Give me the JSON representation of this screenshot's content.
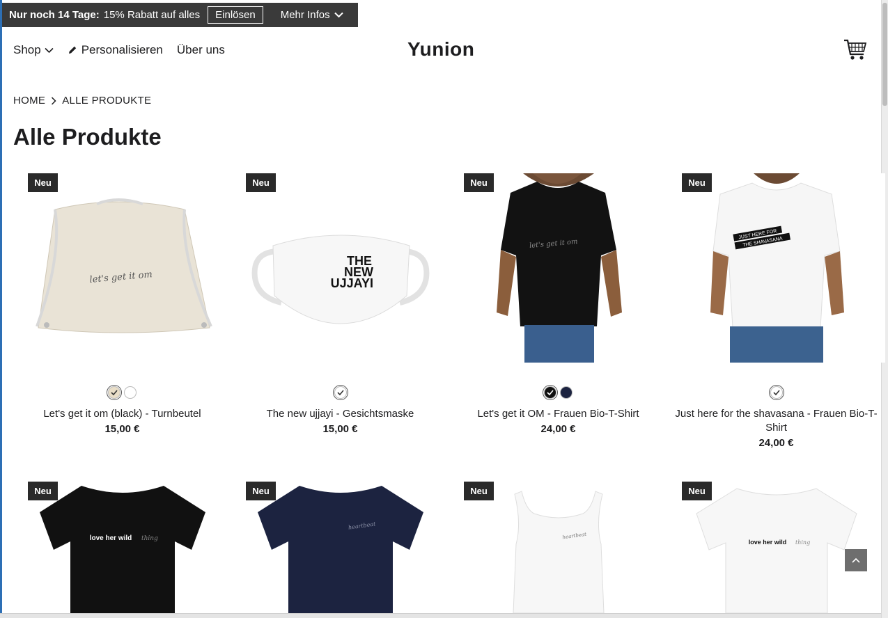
{
  "promo": {
    "lead": "Nur noch 14 Tage:",
    "text": "15% Rabatt auf alles",
    "redeem": "Einlösen",
    "more": "Mehr Infos"
  },
  "nav": {
    "shop": "Shop",
    "personalize": "Personalisieren",
    "about": "Über uns"
  },
  "brand": "Yunion",
  "breadcrumb": {
    "home": "HOME",
    "current": "ALLE PRODUKTE"
  },
  "page_title": "Alle Produkte",
  "badge_label": "Neu",
  "products": [
    {
      "name": "Let's get it om (black) - Turnbeutel",
      "price": "15,00 €",
      "swatches": [
        "#e9dec8",
        "#ffffff"
      ],
      "print": "let's get it om"
    },
    {
      "name": "The new ujjayi - Gesichtsmaske",
      "price": "15,00 €",
      "swatches": [
        "#ffffff"
      ],
      "print": "THE NEW UJJAYI"
    },
    {
      "name": "Let's get it OM - Frauen Bio-T-Shirt",
      "price": "24,00 €",
      "swatches": [
        "#111111",
        "#1c2340"
      ],
      "print": "let's get it om"
    },
    {
      "name": "Just here for the shavasana - Frauen Bio-T-Shirt",
      "price": "24,00 €",
      "swatches": [
        "#ffffff"
      ],
      "print": "JUST HERE FOR THE SHAVASANA"
    },
    {
      "name": "",
      "price": "",
      "print": "love her wild"
    },
    {
      "name": "",
      "price": "",
      "print": "heartbeat"
    },
    {
      "name": "",
      "price": "",
      "print": "heartbeat"
    },
    {
      "name": "",
      "price": "",
      "print": "love her wild"
    }
  ],
  "colors": {
    "accent_dark": "#2a2a2a",
    "promo_bg": "#3a3a3a",
    "navy": "#1c2340"
  }
}
